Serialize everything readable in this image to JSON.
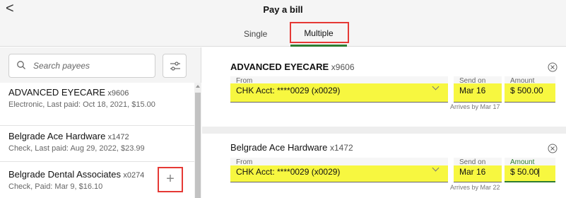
{
  "header": {
    "back_glyph": "<",
    "title": "Pay a bill",
    "tabs": [
      "Single",
      "Multiple"
    ],
    "active_tab": "Multiple",
    "accent_color": "#2e7d32"
  },
  "search": {
    "placeholder": "Search payees",
    "icon": "search-icon"
  },
  "filter_icon": "sliders-icon",
  "payees": [
    {
      "name": "ADVANCED EYECARE",
      "acct": "x9606",
      "detail": "Electronic, Last paid: Oct 18, 2021, $15.00"
    },
    {
      "name": "Belgrade Ace Hardware",
      "acct": "x1472",
      "detail": "Check, Last paid: Aug 29, 2022, $23.99"
    },
    {
      "name": "Belgrade Dental Associates",
      "acct": "x0274",
      "detail": "Check, Paid: Mar 9, $16.10"
    }
  ],
  "add_glyph": "+",
  "payments": [
    {
      "name": "ADVANCED EYECARE",
      "acct": "x9606",
      "from_label": "From",
      "from_value": "CHK Acct: ****0029 (x0029)",
      "send_label": "Send on",
      "send_value": "Mar 16",
      "arrives": "Arrives by Mar 17",
      "amount_label": "Amount",
      "amount_value": "$ 500.00"
    },
    {
      "name": "Belgrade Ace Hardware",
      "acct": "x1472",
      "from_label": "From",
      "from_value": "CHK Acct: ****0029 (x0029)",
      "send_label": "Send on",
      "send_value": "Mar 16",
      "arrives": "Arrives by Mar 22",
      "amount_label": "Amount",
      "amount_value": "$ 50.00"
    }
  ],
  "highlight_color": "#f7f740"
}
